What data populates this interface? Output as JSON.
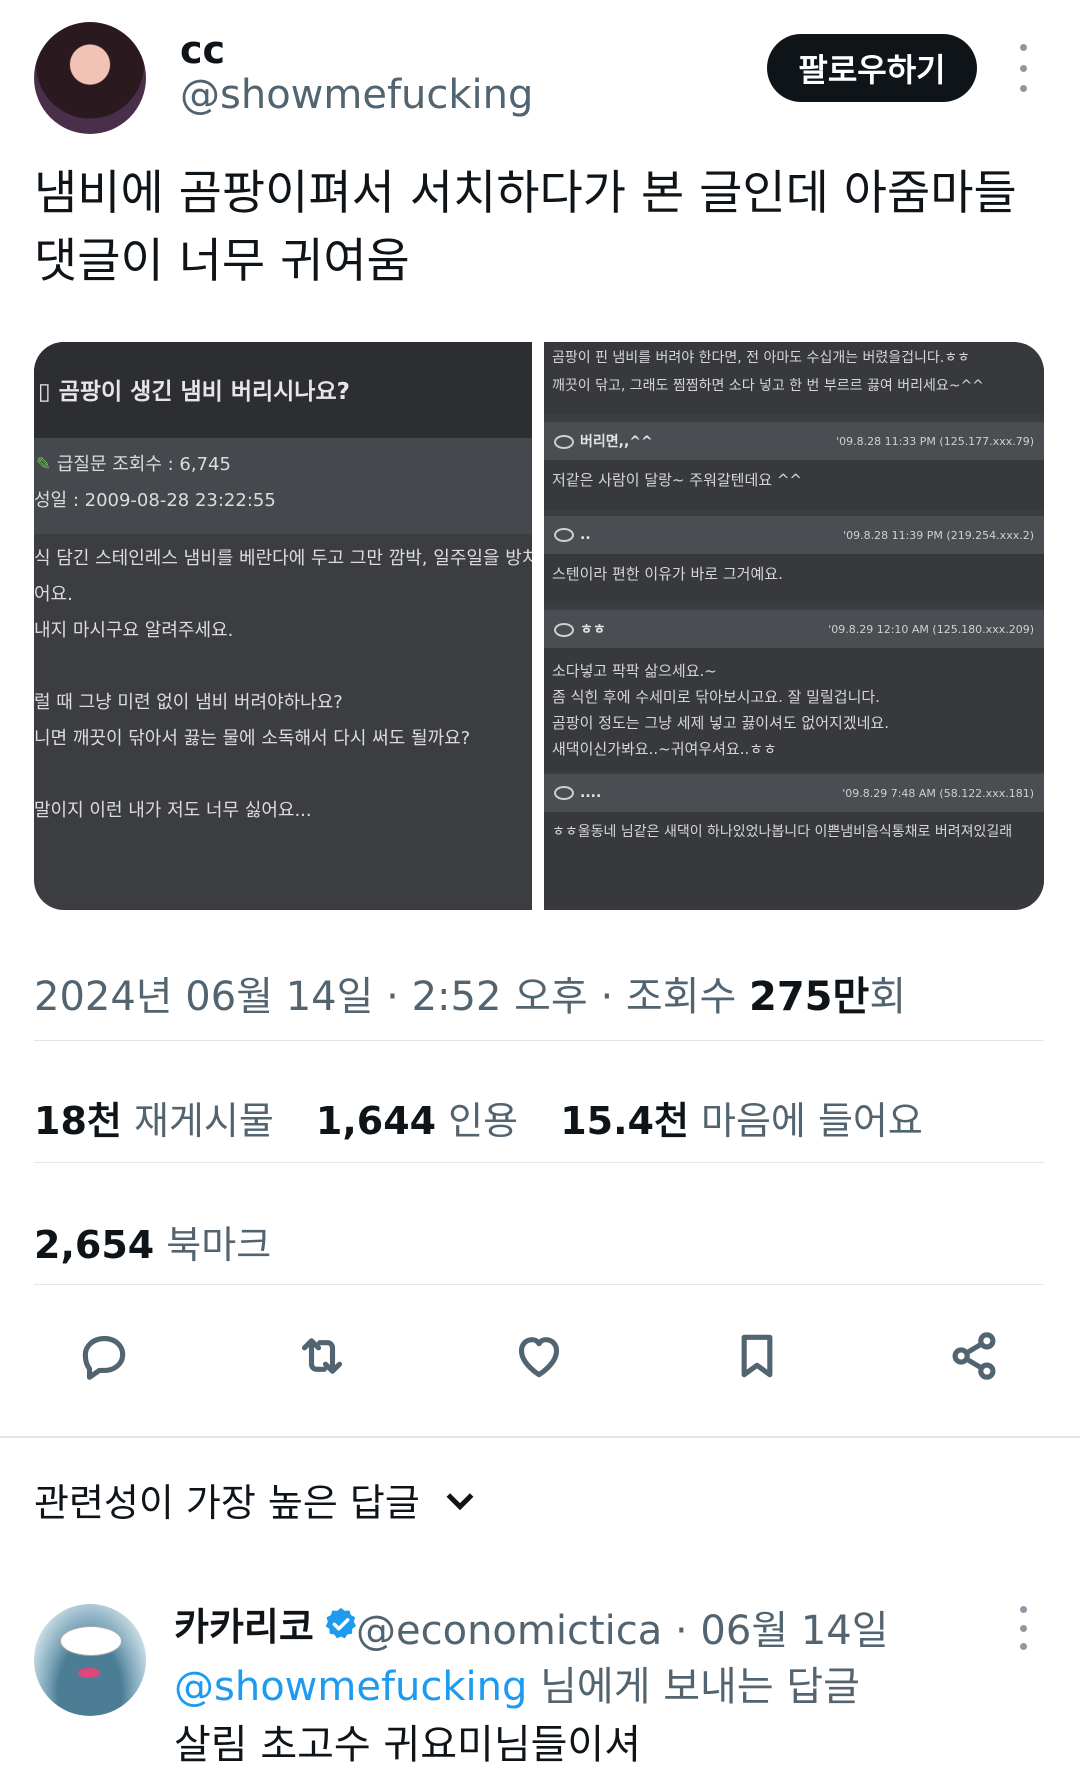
{
  "author": {
    "display_name": "cc",
    "handle": "@showmefucking",
    "follow_label": "팔로우하기"
  },
  "tweet": {
    "text": "냄비에 곰팡이펴서 서치하다가 본 글인데 아줌마들 댓글이 너무 귀여움"
  },
  "media": {
    "left": {
      "title": "곰팡이 생긴 냄비 버리시나요?",
      "meta_line1": "급질문 조회수 : 6,745",
      "meta_line2": "성일 : 2009-08-28 23:22:55",
      "lines": [
        "식 담긴 스테인레스 냄비를 베란다에 두고 그만 깜박, 일주일을 방치",
        "어요.",
        "내지 마시구요 알려주세요.",
        "",
        "럴 때 그냥 미련 없이 냄비 버려야하나요?",
        "니면 깨끗이 닦아서 끓는 물에 소독해서  다시 써도 될까요?",
        "",
        "말이지 이런 내가 저도 너무 싫어요..."
      ]
    },
    "right": {
      "top_lines": [
        "곰팡이 핀 냄비를 버려야 한다면, 전 아마도 수십개는 버렸을겁니다.ㅎㅎ",
        "깨끗이 닦고, 그래도 찜찜하면 소다 넣고 한 번 부르르 끓여 버리세요~^^"
      ],
      "comments": [
        {
          "name": "버리면,,^^",
          "time": "'09.8.28 11:33 PM (125.177.xxx.79)",
          "lines": [
            "저같은 사람이 달랑~ 주워갈텐데요 ^^"
          ]
        },
        {
          "name": "..",
          "time": "'09.8.28 11:39 PM (219.254.xxx.2)",
          "lines": [
            "스텐이라 편한 이유가 바로 그거예요."
          ]
        },
        {
          "name": "ㅎㅎ",
          "time": "'09.8.29 12:10 AM (125.180.xxx.209)",
          "lines": [
            "소다넣고 팍팍 삶으세요.~",
            "좀 식힌 후에 수세미로 닦아보시고요. 잘 밀릴겁니다.",
            "곰팡이 정도는 그냥 세제 넣고 끓이셔도 없어지겠네요.",
            "새댁이신가봐요..~귀여우셔요..ㅎㅎ"
          ]
        },
        {
          "name": "....",
          "time": "'09.8.29 7:48 AM (58.122.xxx.181)",
          "lines": [
            "ㅎㅎ울동네 님같은 새댁이 하나있었나봅니다 이쁜냄비음식통채로 버려져있길래"
          ]
        }
      ]
    }
  },
  "meta": {
    "date": "2024년 06월 14일",
    "time": "2:52 오후",
    "views_label": "조회수",
    "views_value": "275만",
    "views_suffix": "회"
  },
  "stats": {
    "retweets_value": "18천",
    "retweets_label": "재게시물",
    "quotes_value": "1,644",
    "quotes_label": "인용",
    "likes_value": "15.4천",
    "likes_label": "마음에 들어요",
    "bookmarks_value": "2,654",
    "bookmarks_label": "북마크"
  },
  "actions": [
    "reply-icon",
    "retweet-icon",
    "heart-icon",
    "bookmark-icon",
    "share-icon"
  ],
  "replies_section": {
    "sort_label": "관련성이 가장 높은 답글"
  },
  "reply": {
    "display_name": "카카리코",
    "handle_date": "@economictica · 06월 14일",
    "reply_to_mention": "@showmefucking",
    "reply_to_suffix": " 님에게 보내는 답글",
    "text": "살림 초고수 귀요미님들이셔"
  },
  "colors": {
    "accent": "#1d9bf0",
    "secondary_text": "#536471",
    "primary_text": "#0f1419",
    "verified": "#1d9bf0"
  }
}
